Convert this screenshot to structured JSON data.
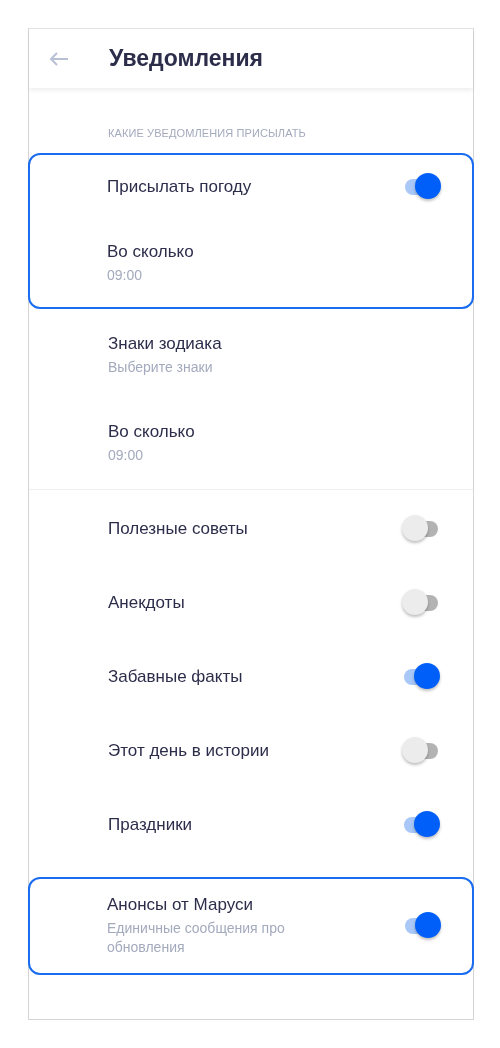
{
  "header": {
    "title": "Уведомления"
  },
  "sections": [
    {
      "label": "КАКИЕ УВЕДОМЛЕНИЯ ПРИСЫЛАТЬ",
      "groups": [
        {
          "highlighted": true,
          "items": [
            {
              "kind": "toggle",
              "label": "Присылать погоду",
              "on": true
            },
            {
              "kind": "detail",
              "label": "Во сколько",
              "value": "09:00"
            }
          ]
        },
        {
          "highlighted": false,
          "items": [
            {
              "kind": "detail",
              "label": "Знаки зодиака",
              "value": "Выберите знаки"
            },
            {
              "kind": "detail",
              "label": "Во сколько",
              "value": "09:00"
            }
          ]
        }
      ]
    },
    {
      "groups": [
        {
          "highlighted": false,
          "items": [
            {
              "kind": "toggle",
              "label": "Полезные советы",
              "on": false
            },
            {
              "kind": "toggle",
              "label": "Анекдоты",
              "on": false
            },
            {
              "kind": "toggle",
              "label": "Забавные факты",
              "on": true
            },
            {
              "kind": "toggle",
              "label": "Этот день в истории",
              "on": false
            },
            {
              "kind": "toggle",
              "label": "Праздники",
              "on": true
            }
          ]
        },
        {
          "highlighted": true,
          "items": [
            {
              "kind": "toggle",
              "label": "Анонсы от Маруси",
              "subtitle": "Единичные сообщения про обновления",
              "on": true
            }
          ]
        }
      ]
    }
  ]
}
